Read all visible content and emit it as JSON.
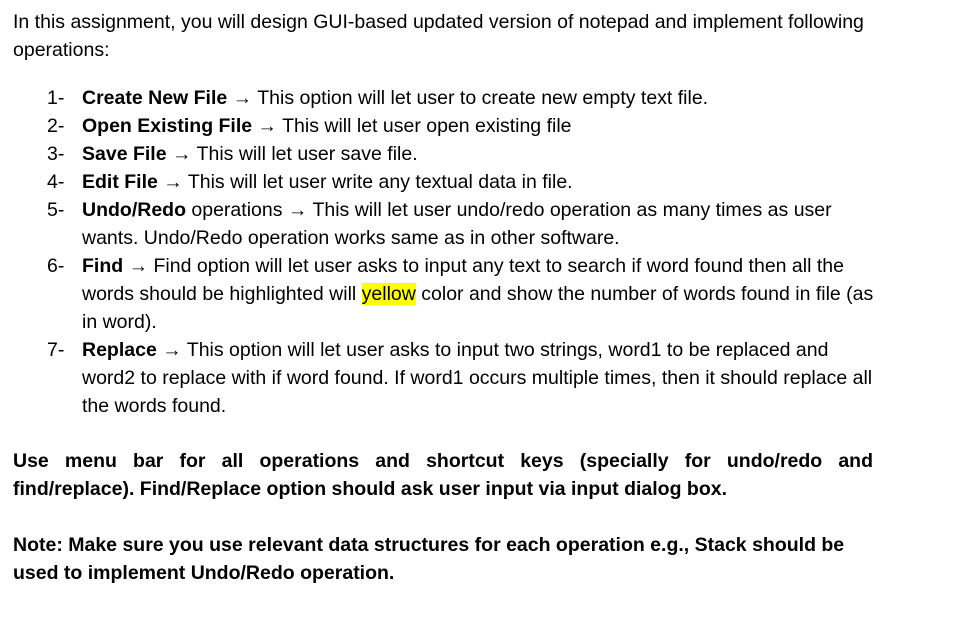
{
  "intro": "In this assignment, you will design GUI-based updated version of notepad and implement following operations:",
  "arrow": "→",
  "operations": [
    {
      "num": "1-",
      "title": "Create New File",
      "desc": "This option will let user to create new empty text file."
    },
    {
      "num": "2-",
      "title": "Open Existing File",
      "desc": "This will let user open existing file"
    },
    {
      "num": "3-",
      "title": "Save File",
      "desc": "This will let user save file."
    },
    {
      "num": "4-",
      "title": "Edit File",
      "desc": "This will let user write any textual data in file."
    },
    {
      "num": "5-",
      "title": "Undo/Redo",
      "title_suffix": " operations",
      "desc": "This will let user undo/redo operation as many times as user wants. Undo/Redo operation works same as in other software."
    },
    {
      "num": "6-",
      "title": "Find",
      "desc_before": "Find option will let user asks to input any text to search if word found then all the words should be highlighted will ",
      "desc_highlight": "yellow",
      "desc_after": " color and show the number of words found in file (as in word)."
    },
    {
      "num": "7-",
      "title": "Replace",
      "desc": "This option will let user asks to input two strings, word1 to be replaced and word2 to replace with if word found. If word1 occurs multiple times, then it should replace all the words found."
    }
  ],
  "menu_note_line1": "Use menu bar for all operations and shortcut keys (specially for undo/redo and",
  "menu_note_line2": "find/replace). Find/Replace option should ask user input via input dialog box.",
  "note": "Note: Make sure you use relevant data structures for each operation e.g., Stack should be used to implement Undo/Redo operation.",
  "colors": {
    "highlight": "#ffff00",
    "text": "#000000"
  }
}
